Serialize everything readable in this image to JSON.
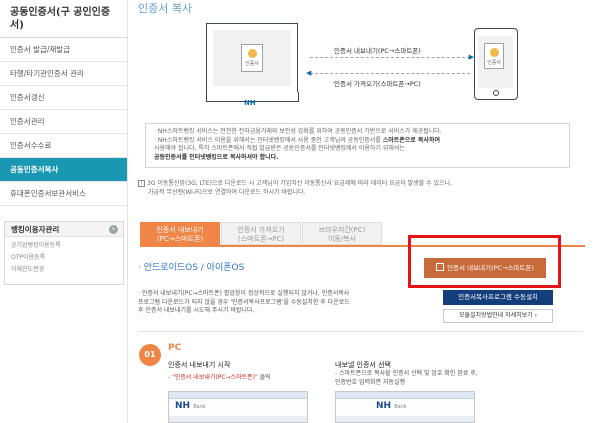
{
  "sidebar": {
    "title": "공동인증서(구 공인인증서)",
    "items": [
      {
        "label": "인증서 발급/재발급",
        "active": false
      },
      {
        "label": "타행/타기관인증서 관리",
        "active": false
      },
      {
        "label": "인증서갱신",
        "active": false
      },
      {
        "label": "인증서관리",
        "active": false
      },
      {
        "label": "인증서수수료",
        "active": false
      },
      {
        "label": "공동인증서복사",
        "active": true
      },
      {
        "label": "휴대폰인증서보관서비스",
        "active": false
      }
    ],
    "box": {
      "title": "뱅킹이용자관리",
      "go": "›",
      "items": [
        "공기업뱅킹이용등록",
        "OTP이용등록",
        "이체한도변경"
      ]
    }
  },
  "main": {
    "title": "인증서 복사",
    "diagram": {
      "pc_label": "NH",
      "cert_label": "인증서",
      "export_label": "인증서 내보내기(PC→스마트폰)",
      "import_label": "인증서 가져오기(스마트폰→PC)",
      "arrow_right": "▶",
      "arrow_left": "◀"
    },
    "notice": {
      "line1": "· NH스마트뱅킹 서비스는 안전한 전자금융거래와 보안성 강화를 위하여 공동인증서 기반으로 서비스가 제공됩니다.",
      "line2_prefix": "· NH스마트뱅킹 서비스 이용을 위해서는 인터넷뱅킹에서 사용 중인 고객님의 공동인증서를 ",
      "line2_highlight": "스마트폰으로 복사하여",
      "line3": "  사용해야 합니다. 특히 스마트폰에서 직접 발급받은 공동인증서를 인터넷뱅킹에서 이용하기 위해서는",
      "line4": "  공동인증서를 인터넷뱅킹으로 복사하셔야 합니다."
    },
    "warning": {
      "mark": "!",
      "line1": "3G 이동통신망(3G, LTE)으로 다운로드 시 고객님이 가입하신 이동통신사 요금제에 따라 데이터 요금이 발생할 수 있으니,",
      "line2": "가급적 무선랜(Wi-Fi)으로 연결하여 다운로드 하시기 바랍니다."
    },
    "tabs": [
      {
        "line1": "인증서 내보내기",
        "line2": "(PC→스마트폰)",
        "active": true
      },
      {
        "line1": "인증서 가져오기",
        "line2": "(스마트폰→PC)",
        "active": false
      },
      {
        "line1": "브라우저간(PC)",
        "line2": "이동/복사",
        "active": false
      }
    ],
    "os_label": "· 안드로이드OS / 아이폰OS",
    "export_button": "인증서 내보내기(PC→스마트폰)",
    "description": {
      "line1": "· 인증서 내보내기(PC→스마트폰) 팝업창이 정상적으로 실행되지 않거나, 인증서복사",
      "line2": "  프로그램 다운로드가 되지 않을 경우 '인증서복사프로그램'을 수동설치한 후 다운로드",
      "line3": "  후 인증서 내보내기를 시도해 주시기 바랍니다."
    },
    "install_button": "인증서복사프로그램 수동설치",
    "guide_button": "모듈설치방법안내 자세히보기 ›",
    "step": {
      "number": "01",
      "label": "PC",
      "s1_title": "인증서 내보내기 시작",
      "s1_desc_prefix": "- ",
      "s1_desc_highlight": "\"인증서 내보내기(PC→스마트폰)\"",
      "s1_desc_suffix": " 클릭",
      "s2_title": "내보낼 인증서 선택",
      "s2_line1": "- 스마트폰으로 복사할 인증서 선택 및 암호 확인 완료 후,",
      "s2_line2": "  인증번호 입력화면 자동실행"
    },
    "thumbs": [
      {
        "logo": "NH",
        "sub": "Bank"
      },
      {
        "logo": "NH",
        "sub": "Bank"
      }
    ]
  },
  "colors": {
    "accent_blue": "#1a97b2",
    "tab_orange": "#ef8648",
    "export_button": "#c86a3a",
    "install_button": "#143e7b",
    "highlight_frame": "#e51414"
  }
}
